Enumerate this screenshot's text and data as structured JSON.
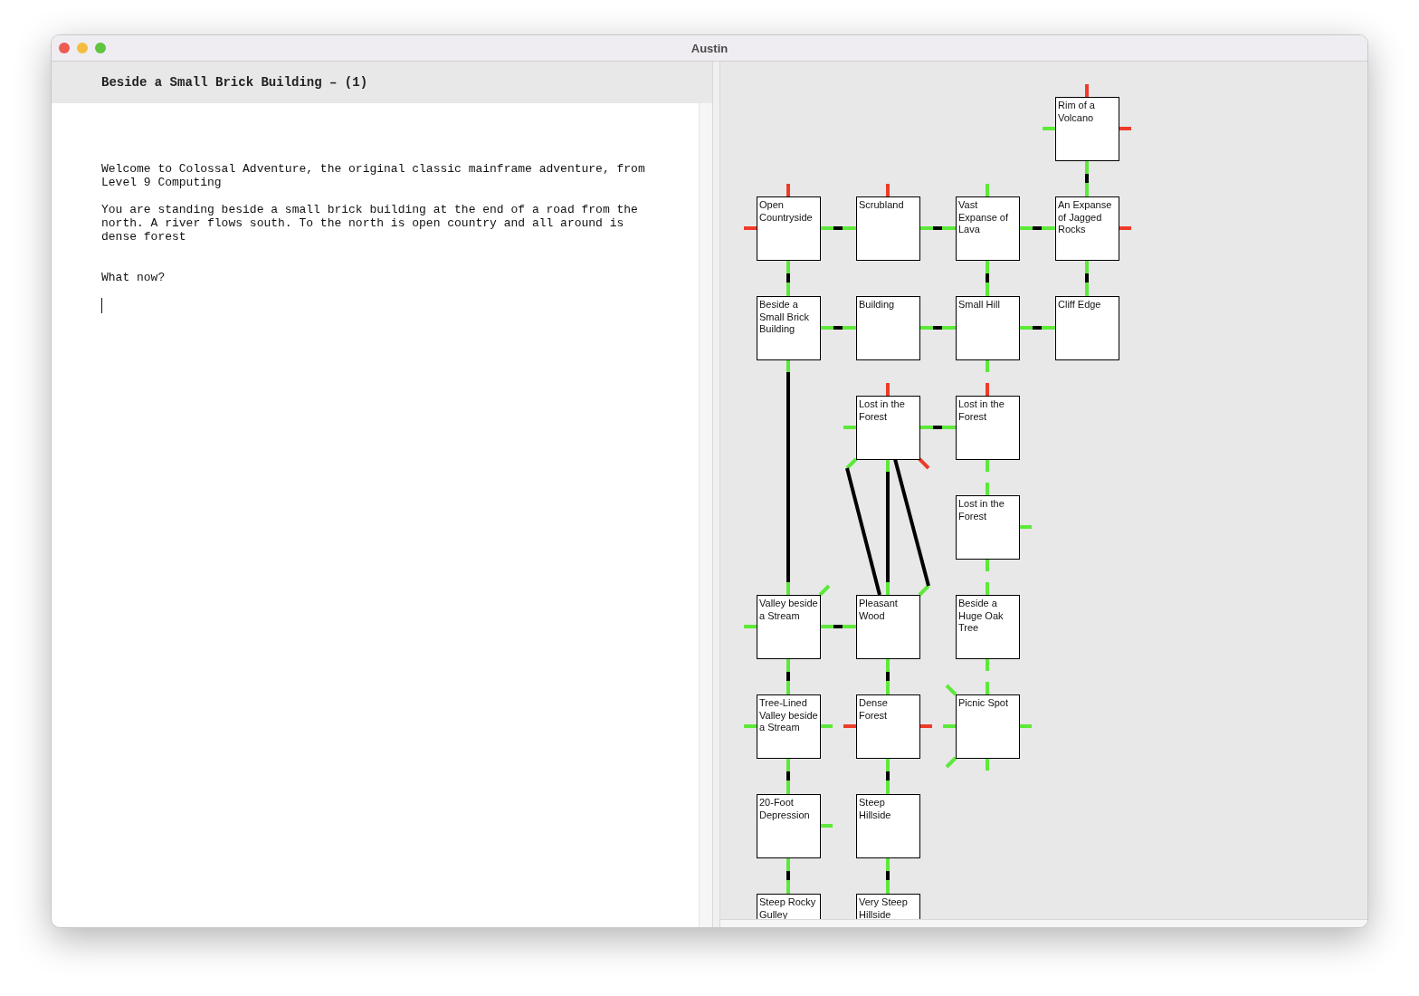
{
  "window": {
    "title": "Austin"
  },
  "location_header": "Beside a Small Brick Building – (1)",
  "transcript": [
    {
      "kind": "text",
      "text": "Welcome to Colossal Adventure, the original classic mainframe adventure, from Level 9 Computing"
    },
    {
      "kind": "text",
      "text": "You are standing beside a small brick building at the end of a road from the north. A river flows south. To the north is open country and all around is dense forest"
    },
    {
      "kind": "prompt",
      "text": "What now?"
    }
  ],
  "map": {
    "rows": [
      [
        null,
        null,
        null,
        {
          "name": "Rim of a Volcano",
          "exits": {
            "n": {
              "kind": "stub",
              "open": false
            },
            "w": {
              "kind": "stub",
              "open": true
            },
            "e": {
              "kind": "stub",
              "open": false
            },
            "s": {
              "kind": "link"
            }
          }
        }
      ],
      [
        {
          "name": "Open Countryside",
          "exits": {
            "n": {
              "kind": "stub",
              "open": false
            },
            "w": {
              "kind": "stub",
              "open": false
            },
            "e": {
              "kind": "link"
            },
            "s": {
              "kind": "link"
            }
          }
        },
        {
          "name": "Scrubland",
          "exits": {
            "n": {
              "kind": "stub",
              "open": false
            },
            "e": {
              "kind": "link"
            }
          }
        },
        {
          "name": "Vast Expanse of Lava",
          "exits": {
            "n": {
              "kind": "stub",
              "open": true
            },
            "e": {
              "kind": "link"
            },
            "s": {
              "kind": "link"
            }
          }
        },
        {
          "name": "An Expanse of Jagged Rocks",
          "exits": {
            "e": {
              "kind": "stub",
              "open": false
            },
            "s": {
              "kind": "link"
            }
          }
        }
      ],
      [
        {
          "name": "Beside a Small Brick Building",
          "exits": {
            "e": {
              "kind": "link"
            },
            "s": {
              "kind": "long"
            }
          }
        },
        {
          "name": "Building",
          "exits": {
            "e": {
              "kind": "link"
            }
          }
        },
        {
          "name": "Small Hill",
          "exits": {
            "e": {
              "kind": "link"
            },
            "s": {
              "kind": "stub",
              "open": true
            }
          }
        },
        {
          "name": "Cliff Edge"
        }
      ],
      [
        null,
        {
          "name": "Lost in the Forest",
          "exits": {
            "n": {
              "kind": "stub",
              "open": false
            },
            "w": {
              "kind": "stub",
              "open": true
            },
            "e": {
              "kind": "link"
            },
            "sw": {
              "kind": "long"
            },
            "s": {
              "kind": "long"
            },
            "se": {
              "kind": "stub",
              "open": false
            }
          }
        },
        {
          "name": "Lost in the Forest",
          "exits": {
            "n": {
              "kind": "stub",
              "open": false
            },
            "s": {
              "kind": "stub",
              "open": true
            }
          }
        },
        null
      ],
      [
        null,
        null,
        {
          "name": "Lost in the Forest",
          "exits": {
            "n": {
              "kind": "stub",
              "open": true
            },
            "e": {
              "kind": "stub",
              "open": true
            },
            "s": {
              "kind": "stub",
              "open": true
            }
          }
        },
        null
      ],
      [
        {
          "name": "Valley beside a Stream",
          "exits": {
            "w": {
              "kind": "stub",
              "open": true
            },
            "ne": {
              "kind": "stub",
              "open": true
            },
            "e": {
              "kind": "link"
            },
            "s": {
              "kind": "link"
            }
          }
        },
        {
          "name": "Pleasant Wood",
          "exits": {
            "ne": {
              "kind": "long"
            },
            "s": {
              "kind": "link"
            }
          }
        },
        {
          "name": "Beside a Huge Oak Tree",
          "exits": {
            "n": {
              "kind": "stub",
              "open": true
            },
            "s": {
              "kind": "stub",
              "open": true
            }
          }
        },
        null
      ],
      [
        {
          "name": "Tree-Lined Valley beside a Stream",
          "exits": {
            "w": {
              "kind": "stub",
              "open": true
            },
            "e": {
              "kind": "stub",
              "open": true
            },
            "s": {
              "kind": "link"
            }
          }
        },
        {
          "name": "Dense Forest",
          "exits": {
            "w": {
              "kind": "stub",
              "open": false
            },
            "e": {
              "kind": "stub",
              "open": false
            },
            "s": {
              "kind": "link"
            }
          }
        },
        {
          "name": "Picnic Spot",
          "exits": {
            "nw": {
              "kind": "stub",
              "open": true
            },
            "n": {
              "kind": "stub",
              "open": true
            },
            "w": {
              "kind": "stub",
              "open": true
            },
            "e": {
              "kind": "stub",
              "open": true
            },
            "sw": {
              "kind": "stub",
              "open": true
            },
            "s": {
              "kind": "stub",
              "open": true
            }
          }
        },
        null
      ],
      [
        {
          "name": "20-Foot Depression",
          "exits": {
            "e": {
              "kind": "stub",
              "open": true
            },
            "s": {
              "kind": "link"
            }
          }
        },
        {
          "name": "Steep Hillside",
          "exits": {
            "s": {
              "kind": "link"
            }
          }
        },
        null,
        null
      ],
      [
        {
          "name": "Steep Rocky Gulley"
        },
        {
          "name": "Very Steep Hillside"
        },
        null,
        null
      ]
    ]
  }
}
